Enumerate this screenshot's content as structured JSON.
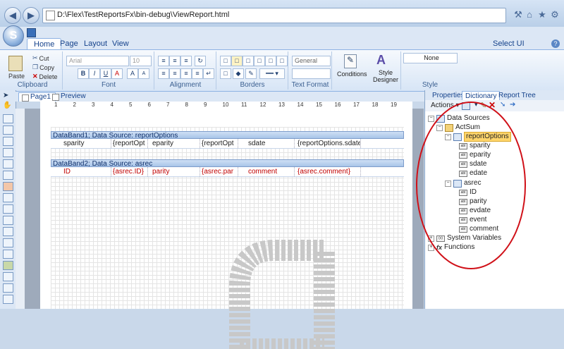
{
  "browser": {
    "address": "D:\\Flex\\TestReportsFx\\bin-debug\\ViewReport.html"
  },
  "ribbon": {
    "tabs": [
      "Home",
      "Page",
      "Layout",
      "View"
    ],
    "active_tab": "Home",
    "ui_language": "Select UI Language",
    "clipboard": {
      "paste": "Paste",
      "cut": "Cut",
      "copy": "Copy",
      "delete": "Delete",
      "label": "Clipboard"
    },
    "font": {
      "family": "Arial",
      "size": "10",
      "label": "Font"
    },
    "alignment_label": "Alignment",
    "borders_label": "Borders",
    "text_format": {
      "combo": "General",
      "label": "Text Format"
    },
    "conditions": "Conditions",
    "style_designer": "Style Designer",
    "style": {
      "combo": "None",
      "label": "Style"
    }
  },
  "document": {
    "tabs": [
      "Page1",
      "Preview"
    ],
    "ruler": [
      "1",
      "2",
      "3",
      "4",
      "5",
      "6",
      "7",
      "8",
      "9",
      "10",
      "11",
      "12",
      "13",
      "14",
      "15",
      "16",
      "17",
      "18",
      "19"
    ],
    "band1": {
      "title": "DataBand1; Data Source: reportOptions",
      "cells": [
        "sparity",
        "{reportOpt",
        "eparity",
        "{reportOpt",
        "sdate",
        "{reportOptions.sdate}"
      ]
    },
    "band2": {
      "title": "DataBand2; Data Source: asrec",
      "cells": [
        "ID",
        "{asrec.ID}",
        "parity",
        "{asrec.par",
        "comment",
        "{asrec.comment}"
      ]
    }
  },
  "panel": {
    "tabs": [
      "Properties",
      "Dictionary",
      "Report Tree"
    ],
    "active_tab": "Dictionary",
    "actions": "Actions",
    "tree": {
      "root": "Data Sources",
      "connection": "ActSum",
      "source1": "reportOptions",
      "source1_fields": [
        "sparity",
        "eparity",
        "sdate",
        "edate"
      ],
      "source2": "asrec",
      "source2_fields": [
        "ID",
        "parity",
        "evdate",
        "event",
        "comment"
      ],
      "system_variables": "System Variables",
      "functions": "Functions"
    }
  },
  "colors": {
    "accent": "#15428b",
    "annotation": "#d01018",
    "band_text_red": "#c00000"
  }
}
